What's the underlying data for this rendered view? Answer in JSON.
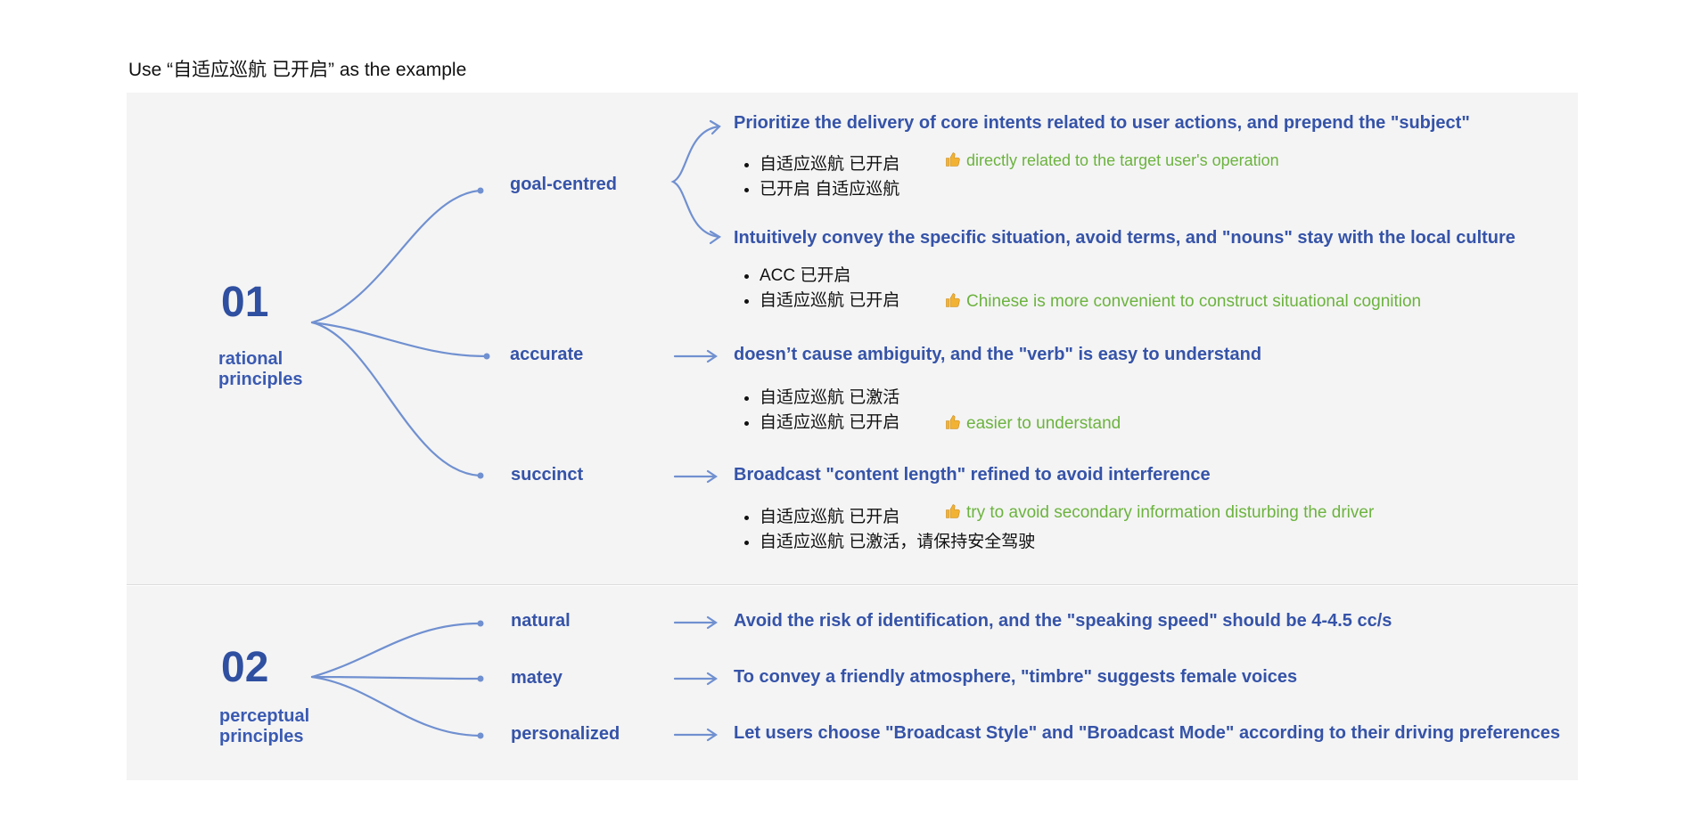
{
  "title": "Use “自适应巡航 已开启” as the example",
  "colors": {
    "heading": "#3553a8",
    "note": "#6cb33f",
    "line": "#7090d0",
    "panel": "#f4f4f4"
  },
  "groups": [
    {
      "number": "01",
      "label_line1": "rational",
      "label_line2": "principles",
      "nodes": [
        {
          "name": "goal-centred"
        },
        {
          "name": "accurate"
        },
        {
          "name": "succinct"
        }
      ]
    },
    {
      "number": "02",
      "label_line1": "perceptual",
      "label_line2": "principles",
      "nodes": [
        {
          "name": "natural"
        },
        {
          "name": "matey"
        },
        {
          "name": "personalized"
        }
      ]
    }
  ],
  "goal": {
    "desc1": "Prioritize the delivery of core intents related to user actions, and prepend the \"subject\"",
    "ex1": [
      "自适应巡航 已开启",
      "已开启 自适应巡航"
    ],
    "note1": "directly related to the target user's operation",
    "desc2": "Intuitively convey the specific situation, avoid terms, and \"nouns\" stay with the local culture",
    "ex2": [
      "ACC 已开启",
      "自适应巡航 已开启"
    ],
    "note2": "Chinese is more convenient to construct situational cognition"
  },
  "accurate": {
    "desc": "doesn’t cause ambiguity, and the \"verb\" is easy to understand",
    "ex": [
      "自适应巡航 已激活",
      "自适应巡航 已开启"
    ],
    "note": "easier to understand"
  },
  "succinct": {
    "desc": "Broadcast \"content length\" refined to avoid interference",
    "ex": [
      "自适应巡航 已开启",
      "自适应巡航 已激活，请保持安全驾驶"
    ],
    "note": "try to avoid secondary information disturbing the driver"
  },
  "perceptual": {
    "natural": "Avoid the risk of identification, and the \"speaking speed\" should be 4-4.5 cc/s",
    "matey": "To convey a friendly atmosphere, \"timbre\" suggests female voices",
    "personalized": "Let users choose \"Broadcast Style\" and \"Broadcast Mode\" according to their driving preferences"
  }
}
